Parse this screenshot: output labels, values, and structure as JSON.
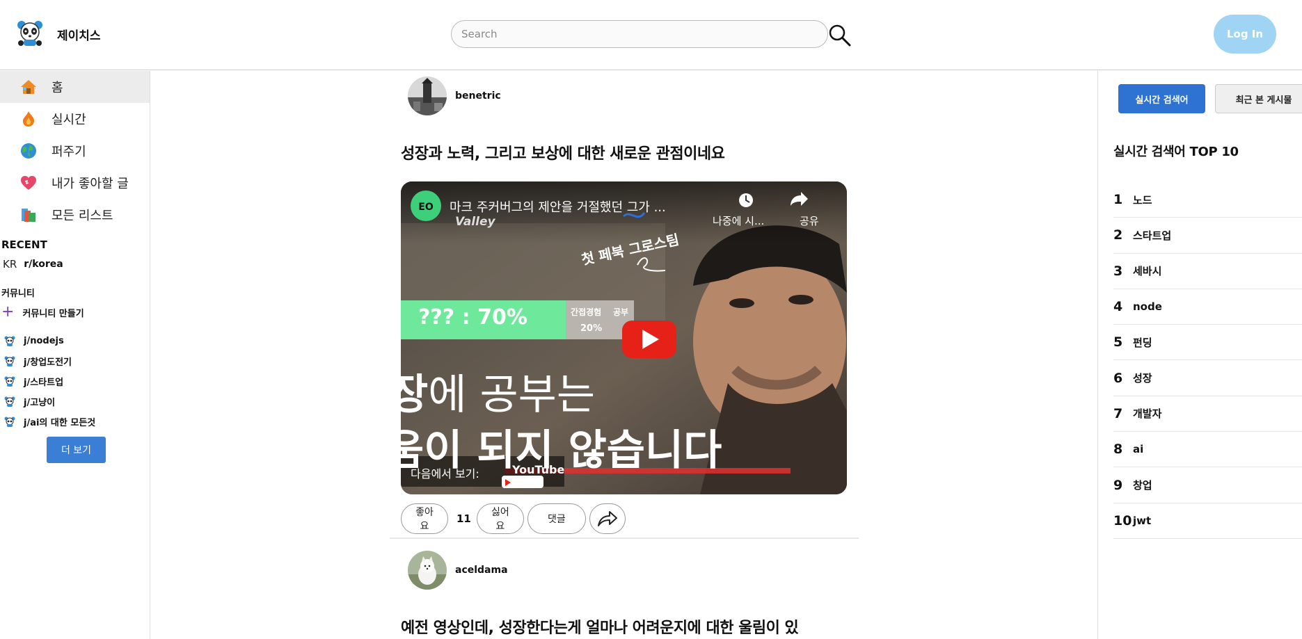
{
  "header": {
    "brand": "제이치스",
    "search_placeholder": "Search",
    "login_label": "Log In"
  },
  "sidebar": {
    "nav": [
      {
        "label": "홈",
        "icon": "house-icon"
      },
      {
        "label": "실시간",
        "icon": "fire-icon"
      },
      {
        "label": "퍼주기",
        "icon": "globe-icon"
      },
      {
        "label": "내가 좋아할 글",
        "icon": "heart-icon"
      },
      {
        "label": "모든 리스트",
        "icon": "books-icon"
      }
    ],
    "recent_title": "RECENT",
    "recent": [
      {
        "prefix": "KR",
        "label": "r/korea"
      }
    ],
    "community_title": "커뮤니티",
    "create_label": "커뮤니티 만들기",
    "communities": [
      "j/nodejs",
      "j/창업도전기",
      "j/스타트업",
      "j/고냥이",
      "j/ai의 대한 모든것"
    ],
    "more_label": "더 보기"
  },
  "feed": {
    "posts": [
      {
        "author": "benetric",
        "title": "성장과 노력, 그리고 보상에 대한 새로운 관점이네요",
        "video": {
          "title": "마크 주커버그의 제안을 거절했던 그가 ...",
          "channel_logo": "EO",
          "watch_later": "나중에 시...",
          "share": "공유",
          "overlay_tag": "첫 페북 그로스팀",
          "bar_label": "??? : 70%",
          "bar_tag1": "간접경험",
          "bar_tag2": "공부",
          "bar_tag3": "20%",
          "caption_line1_bold": "장",
          "caption_line1_rest": "에 공부는",
          "caption_line2": "움이 되지 않습니다",
          "watch_on": "다음에서 보기:",
          "youtube": "YouTube",
          "valley": "Valley"
        },
        "like_label": "좋아요",
        "like_count": "11",
        "dislike_label": "싫어요",
        "comment_label": "댓글"
      },
      {
        "author": "aceldama",
        "title": "예전 영상인데, 성장한다는게 얼마나 어려운지에 대한 울림이 있"
      }
    ]
  },
  "right": {
    "tab_live": "실시간 검색어",
    "tab_recent": "최근 본 게시물",
    "trend_title": "실시간 검색어 TOP 10",
    "trends": [
      {
        "rank": "1",
        "term": "노드"
      },
      {
        "rank": "2",
        "term": "스타트업"
      },
      {
        "rank": "3",
        "term": "세바시"
      },
      {
        "rank": "4",
        "term": "node"
      },
      {
        "rank": "5",
        "term": "펀딩"
      },
      {
        "rank": "6",
        "term": "성장"
      },
      {
        "rank": "7",
        "term": "개발자"
      },
      {
        "rank": "8",
        "term": "ai"
      },
      {
        "rank": "9",
        "term": "창업"
      },
      {
        "rank": "10",
        "term": "jwt"
      }
    ]
  },
  "colors": {
    "login": "#9fd4f5",
    "primary": "#3a7fd5",
    "video_green_bar": "#6ee89a",
    "youtube_red": "#e62117"
  }
}
